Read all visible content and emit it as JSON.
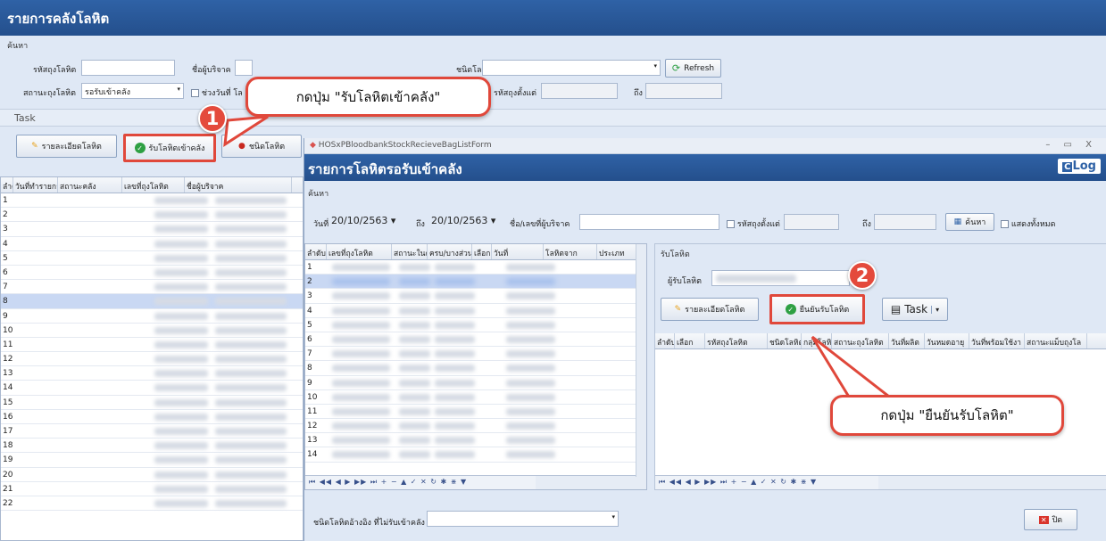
{
  "main": {
    "title": "รายการคลังโลหิต",
    "search_group": "ค้นหา",
    "label_bag_id": "รหัสถุงโลหิต",
    "label_donor": "ชื่อผู้บริจาค",
    "label_blood_group": "กรุ๊ปโลหิต",
    "label_blood_type": "ชนิดโลหิต",
    "label_bag_status": "สถานะถุงโลหิต",
    "bag_status_value": "รอรับเข้าคลัง",
    "label_date_range": "ช่วงวันที่ โล",
    "label_bag_from": "รหัสถุงตั้งแต่",
    "label_to": "ถึง",
    "refresh": "Refresh",
    "task_label": "Task",
    "btn_detail": "รายละเอียดโลหิต",
    "btn_receive": "รับโลหิตเข้าคลัง",
    "btn_type": "ชนิดโลหิต",
    "cols": [
      "ลำดับ",
      "วันที่ทำรายการ",
      "สถานะคลัง",
      "เลขที่ถุงโลหิต",
      "ชื่อผู้บริจาค"
    ],
    "rows": [
      "1",
      "2",
      "3",
      "4",
      "5",
      "6",
      "7",
      "8",
      "9",
      "10",
      "11",
      "12",
      "13",
      "14",
      "15",
      "16",
      "17",
      "18",
      "19",
      "20",
      "21",
      "22"
    ]
  },
  "dialog": {
    "window_title": "HOSxPBloodbankStockRecieveBagListForm",
    "title": "รายการโลหิตรอรับเข้าคลัง",
    "log": "Log",
    "search_group": "ค้นหา",
    "label_date": "วันที่",
    "date_from": "20/10/2563",
    "label_to": "ถึง",
    "date_to": "20/10/2563",
    "label_name": "ชื่อ/เลขที่ผู้บริจาค",
    "label_bag_from": "รหัสถุงตั้งแต่",
    "label_to2": "ถึง",
    "search_btn": "ค้นหา",
    "show_all": "แสดงทั้งหมด",
    "cols": [
      "ลำดับ",
      "เลขที่ถุงโลหิต",
      "สถานะในค",
      "ครบ/บางส่วน",
      "เลือก",
      "วันที่",
      "โลหิตจาก",
      "ประเภท"
    ],
    "rows": [
      "1",
      "2",
      "3",
      "4",
      "5",
      "6",
      "7",
      "8",
      "9",
      "10",
      "11",
      "12",
      "13",
      "14"
    ],
    "receive_group": "รับโลหิต",
    "label_receiver": "ผู้รับโลหิต",
    "btn_detail": "รายละเอียดโลหิต",
    "btn_confirm": "ยืนยันรับโลหิต",
    "btn_task": "Task",
    "right_cols": [
      "ลำดับ",
      "เลือก",
      "รหัสถุงโลหิต",
      "ชนิดโลหิต",
      "กลุ่มโลหิ",
      "สถานะถุงโลหิต",
      "วันที่ผลิต",
      "วันหมดอายุ",
      "วันที่พร้อมใช้งา",
      "สถานะแม็บถุงโล"
    ],
    "bottom_label": "ชนิดโลหิตอ้างอิง ที่ไม่รับเข้าคลัง",
    "close": "ปิด",
    "win_controls": "– ▭ X"
  },
  "callouts": {
    "step1_num": "1",
    "step1_text": "กดปุ่ม \"รับโลหิตเข้าคลัง\"",
    "step2_num": "2",
    "step2_text": "กดปุ่ม \"ยืนยันรับโลหิต\""
  },
  "colors": {
    "accent": "#2f62a6",
    "highlight": "#e0483b",
    "confirm": "#2ea043"
  }
}
